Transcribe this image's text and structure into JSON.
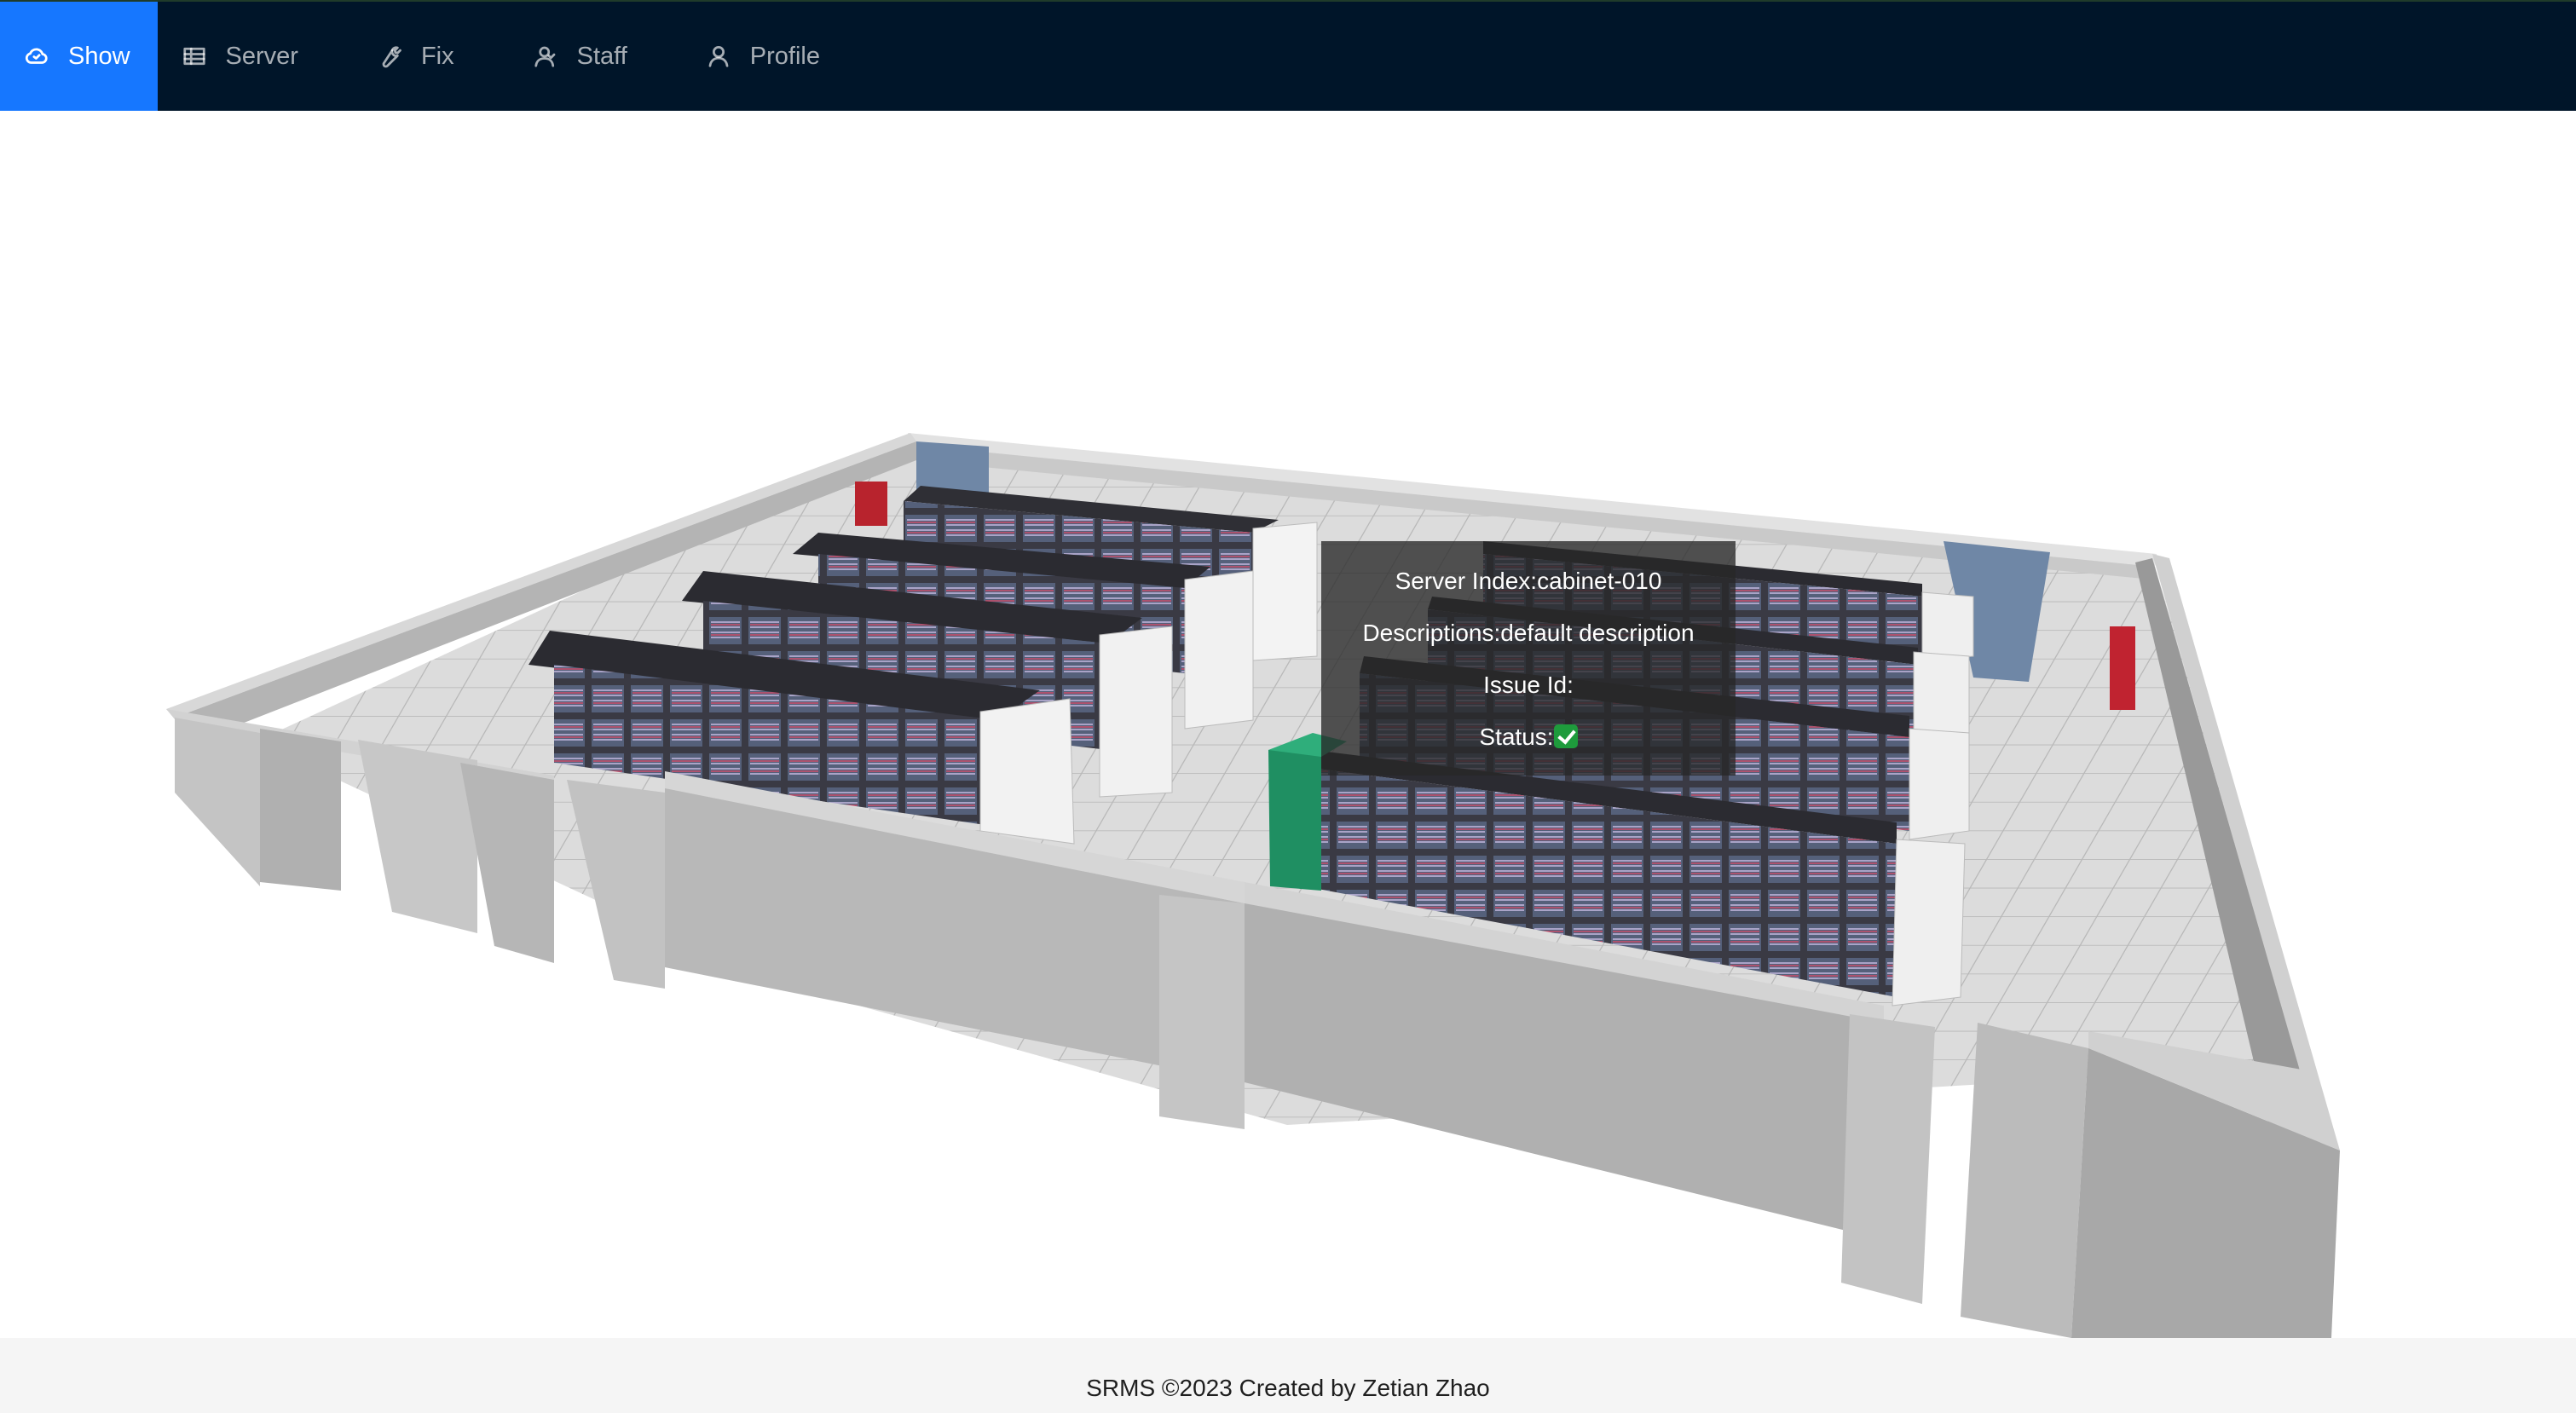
{
  "nav": {
    "items": [
      {
        "label": "Show",
        "icon": "cloud-icon",
        "active": true
      },
      {
        "label": "Server",
        "icon": "table-icon",
        "active": false
      },
      {
        "label": "Fix",
        "icon": "wrench-icon",
        "active": false
      },
      {
        "label": "Staff",
        "icon": "team-icon",
        "active": false
      },
      {
        "label": "Profile",
        "icon": "user-icon",
        "active": false
      }
    ],
    "background": "#001529",
    "active_color": "#1677ff"
  },
  "tooltip": {
    "server_index": "Server Index:cabinet-010",
    "descriptions": "Descriptions:default description",
    "issue_id": "Issue Id:",
    "status_label": "Status:",
    "status_icon": "check-mark-icon"
  },
  "footer": {
    "text": "SRMS ©2023 Created by Zetian Zhao"
  }
}
